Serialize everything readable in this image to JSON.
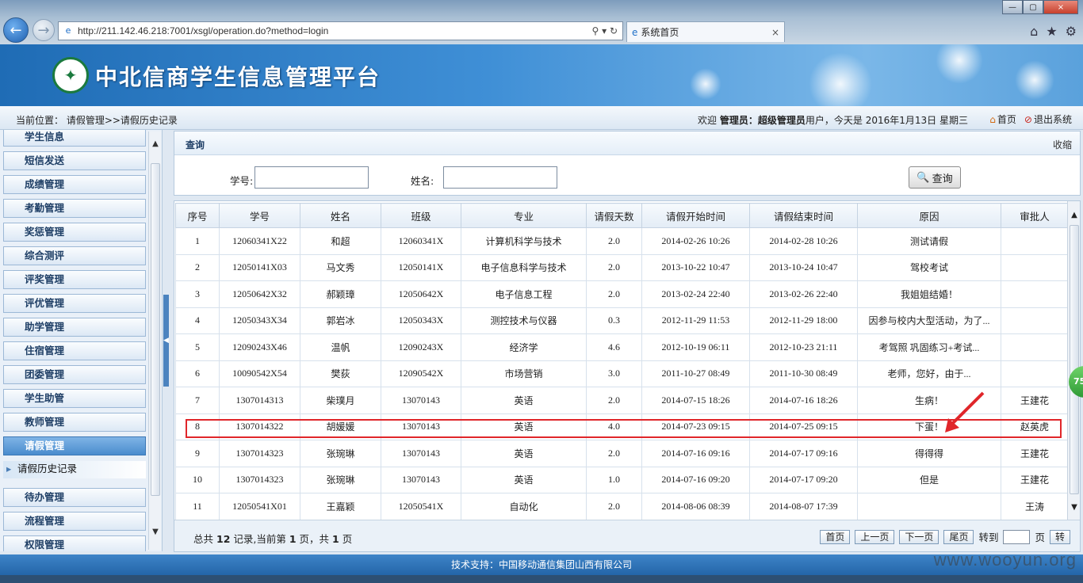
{
  "browser": {
    "url": "http://211.142.46.218:7001/xsgl/operation.do?method=login",
    "tab_title": "系统首页"
  },
  "banner": {
    "title": "中北信商学生信息管理平台"
  },
  "crumb": {
    "location": "当前位置： 请假管理>>请假历史记录",
    "welcome_prefix": "欢迎",
    "role": "管理员：",
    "user": "超级管理员",
    "welcome_suffix": "用户，今天是 2016年1月13日 星期三",
    "home": "首页",
    "logout": "退出系统"
  },
  "sidebar": {
    "items": [
      {
        "label": "学生信息"
      },
      {
        "label": "短信发送"
      },
      {
        "label": "成绩管理"
      },
      {
        "label": "考勤管理"
      },
      {
        "label": "奖惩管理"
      },
      {
        "label": "综合测评"
      },
      {
        "label": "评奖管理"
      },
      {
        "label": "评优管理"
      },
      {
        "label": "助学管理"
      },
      {
        "label": "住宿管理"
      },
      {
        "label": "团委管理"
      },
      {
        "label": "学生助管"
      },
      {
        "label": "教师管理"
      },
      {
        "label": "请假管理"
      }
    ],
    "sub_item": "请假历史记录",
    "items_after": [
      {
        "label": "待办管理"
      },
      {
        "label": "流程管理"
      },
      {
        "label": "权限管理"
      }
    ]
  },
  "query": {
    "title": "查询",
    "collapse": "收缩",
    "student_id_label": "学号:",
    "name_label": "姓名:",
    "query_button": "查询",
    "student_id_value": "",
    "name_value": ""
  },
  "table": {
    "headers": [
      "序号",
      "学号",
      "姓名",
      "班级",
      "专业",
      "请假天数",
      "请假开始时间",
      "请假结束时间",
      "原因",
      "审批人"
    ],
    "rows": [
      [
        "1",
        "12060341X22",
        "和超",
        "12060341X",
        "计算机科学与技术",
        "2.0",
        "2014-02-26 10:26",
        "2014-02-28 10:26",
        "测试请假",
        ""
      ],
      [
        "2",
        "12050141X03",
        "马文秀",
        "12050141X",
        "电子信息科学与技术",
        "2.0",
        "2013-10-22 10:47",
        "2013-10-24 10:47",
        "驾校考试",
        ""
      ],
      [
        "3",
        "12050642X32",
        "郝颖璋",
        "12050642X",
        "电子信息工程",
        "2.0",
        "2013-02-24 22:40",
        "2013-02-26 22:40",
        "我姐姐结婚！",
        ""
      ],
      [
        "4",
        "12050343X34",
        "郭岩冰",
        "12050343X",
        "测控技术与仪器",
        "0.3",
        "2012-11-29 11:53",
        "2012-11-29 18:00",
        "因参与校内大型活动，为了...",
        ""
      ],
      [
        "5",
        "12090243X46",
        "温帆",
        "12090243X",
        "经济学",
        "4.6",
        "2012-10-19 06:11",
        "2012-10-23 21:11",
        "考驾照 巩固练习+考试...",
        ""
      ],
      [
        "6",
        "10090542X54",
        "樊荻",
        "12090542X",
        "市场营销",
        "3.0",
        "2011-10-27 08:49",
        "2011-10-30 08:49",
        "老师，您好，由于...",
        ""
      ],
      [
        "7",
        "1307014313",
        "柴璞月",
        "13070143",
        "英语",
        "2.0",
        "2014-07-15 18:26",
        "2014-07-16 18:26",
        "生病！",
        "王建花"
      ],
      [
        "8",
        "1307014322",
        "胡媛媛",
        "13070143",
        "英语",
        "4.0",
        "2014-07-23 09:15",
        "2014-07-25 09:15",
        "下蛋！",
        "赵英虎"
      ],
      [
        "9",
        "1307014323",
        "张琬琳",
        "13070143",
        "英语",
        "2.0",
        "2014-07-16 09:16",
        "2014-07-17 09:16",
        "得得得",
        "王建花"
      ],
      [
        "10",
        "1307014323",
        "张琬琳",
        "13070143",
        "英语",
        "1.0",
        "2014-07-16 09:20",
        "2014-07-17 09:20",
        "但是",
        "王建花"
      ],
      [
        "11",
        "12050541X01",
        "王嘉颖",
        "12050541X",
        "自动化",
        "2.0",
        "2014-08-06 08:39",
        "2014-08-07 17:39",
        "",
        "王涛"
      ]
    ]
  },
  "pager": {
    "text_total": "总共",
    "total": "12",
    "text_records": "记录,当前第",
    "current": "1",
    "text_pages": "页，共",
    "pages": "1",
    "text_page_unit": "页",
    "first": "首页",
    "prev": "上一页",
    "next": "下一页",
    "last": "尾页",
    "goto": "转到",
    "page_suffix": "页",
    "go": "转"
  },
  "footer": {
    "text": "技术支持：中国移动通信集团山西有限公司"
  },
  "watermark": "www.wooyun.org",
  "side_badge": "75",
  "colors": {
    "highlight": "#e0262a",
    "banner": "#2f7dc4",
    "active_menu": "#4a8ccd"
  }
}
